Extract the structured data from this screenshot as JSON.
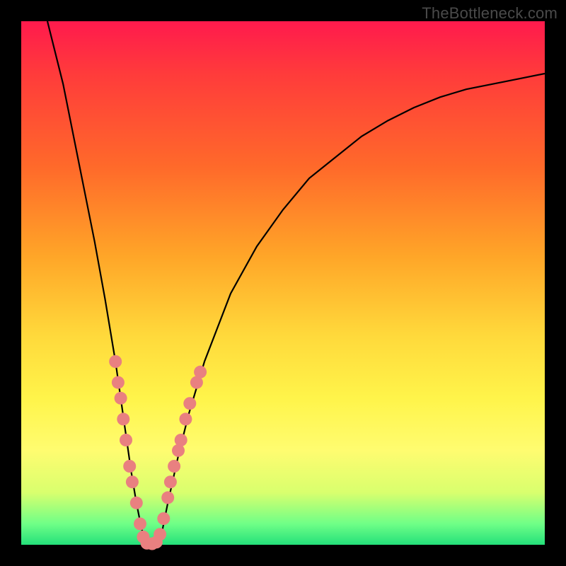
{
  "watermark": "TheBottleneck.com",
  "chart_data": {
    "type": "line",
    "title": "",
    "xlabel": "",
    "ylabel": "",
    "xlim": [
      0,
      100
    ],
    "ylim": [
      0,
      100
    ],
    "grid": false,
    "series": [
      {
        "name": "bottleneck-curve",
        "x": [
          5,
          8,
          10,
          12,
          14,
          16,
          18,
          19,
          20,
          21,
          22,
          23,
          24,
          25,
          26,
          27,
          28,
          30,
          32,
          35,
          40,
          45,
          50,
          55,
          60,
          65,
          70,
          75,
          80,
          85,
          90,
          95,
          100
        ],
        "y": [
          100,
          88,
          78,
          68,
          58,
          47,
          35,
          28,
          21,
          14,
          8,
          3,
          0,
          0,
          0,
          3,
          8,
          17,
          25,
          35,
          48,
          57,
          64,
          70,
          74,
          78,
          81,
          83.5,
          85.5,
          87,
          88,
          89,
          90
        ]
      }
    ],
    "markers": {
      "name": "highlight-dots",
      "color": "#e98080",
      "points": [
        {
          "x": 18.0,
          "y": 35
        },
        {
          "x": 18.5,
          "y": 31
        },
        {
          "x": 19.0,
          "y": 28
        },
        {
          "x": 19.5,
          "y": 24
        },
        {
          "x": 20.0,
          "y": 20
        },
        {
          "x": 20.7,
          "y": 15
        },
        {
          "x": 21.2,
          "y": 12
        },
        {
          "x": 22.0,
          "y": 8
        },
        {
          "x": 22.7,
          "y": 4
        },
        {
          "x": 23.3,
          "y": 1.5
        },
        {
          "x": 24.0,
          "y": 0.3
        },
        {
          "x": 25.0,
          "y": 0.2
        },
        {
          "x": 25.8,
          "y": 0.5
        },
        {
          "x": 26.5,
          "y": 2
        },
        {
          "x": 27.2,
          "y": 5
        },
        {
          "x": 28.0,
          "y": 9
        },
        {
          "x": 28.5,
          "y": 12
        },
        {
          "x": 29.2,
          "y": 15
        },
        {
          "x": 30.0,
          "y": 18
        },
        {
          "x": 30.5,
          "y": 20
        },
        {
          "x": 31.4,
          "y": 24
        },
        {
          "x": 32.2,
          "y": 27
        },
        {
          "x": 33.5,
          "y": 31
        },
        {
          "x": 34.2,
          "y": 33
        }
      ]
    }
  }
}
